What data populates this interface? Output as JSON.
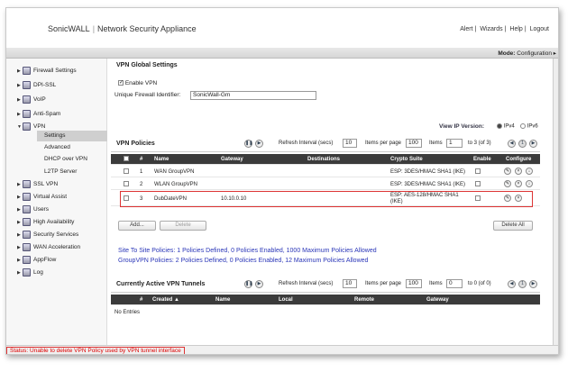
{
  "header": {
    "brand": "SonicWALL",
    "product": "Network Security Appliance",
    "links": [
      "Alert",
      "Wizards",
      "Help",
      "Logout"
    ]
  },
  "modebar": {
    "label": "Mode:",
    "value": "Configuration ▸"
  },
  "sidebar": {
    "items": [
      {
        "label": "Firewall Settings"
      },
      {
        "label": "DPI-SSL"
      },
      {
        "label": "VoIP"
      },
      {
        "label": "Anti-Spam"
      },
      {
        "label": "VPN"
      }
    ],
    "sub": [
      {
        "label": "Settings"
      },
      {
        "label": "Advanced"
      },
      {
        "label": "DHCP over VPN"
      },
      {
        "label": "L2TP Server"
      }
    ],
    "items2": [
      {
        "label": "SSL VPN"
      },
      {
        "label": "Virtual Assist"
      },
      {
        "label": "Users"
      },
      {
        "label": "High Availability"
      },
      {
        "label": "Security Services"
      },
      {
        "label": "WAN Acceleration"
      },
      {
        "label": "AppFlow"
      },
      {
        "label": "Log"
      }
    ]
  },
  "global": {
    "title": "VPN Global Settings",
    "enable_label": "Enable VPN",
    "uid_label": "Unique Firewall Identifier:",
    "uid_value": "SonicWall-Gm"
  },
  "ipversion": {
    "label": "View IP Version:",
    "v4": "IPv4",
    "v6": "IPv6"
  },
  "policies": {
    "title": "VPN Policies",
    "refresh_label": "Refresh Interval (secs)",
    "refresh_value": "10",
    "perpage_label": "Items per page",
    "perpage_value": "100",
    "items_label": "Items",
    "items_value": "1",
    "range": "to 3 (of 3)",
    "headers": [
      "#",
      "Name",
      "Gateway",
      "Destinations",
      "Crypto Suite",
      "Enable",
      "Configure"
    ],
    "rows": [
      {
        "num": "1",
        "name": "WAN GroupVPN",
        "gateway": "",
        "dest": "",
        "crypto": "ESP: 3DES/HMAC SHA1 (IKE)"
      },
      {
        "num": "2",
        "name": "WLAN GroupVPN",
        "gateway": "",
        "dest": "",
        "crypto": "ESP: 3DES/HMAC SHA1 (IKE)"
      },
      {
        "num": "3",
        "name": "DubDateVPN",
        "gateway": "10.10.0.10",
        "dest": "",
        "crypto": "ESP: AES-128/HMAC SHA1 (IKE)"
      }
    ],
    "add": "Add...",
    "delete": "Delete",
    "delete_all": "Delete All",
    "summary1": "Site To Site Policies: 1 Policies Defined, 0 Policies Enabled, 1000 Maximum Policies Allowed",
    "summary2": "GroupVPN Policies: 2 Policies Defined, 0 Policies Enabled, 12 Maximum Policies Allowed"
  },
  "tunnels": {
    "title": "Currently Active VPN Tunnels",
    "refresh_label": "Refresh Interval (secs)",
    "refresh_value": "10",
    "perpage_label": "Items per page",
    "perpage_value": "100",
    "items_label": "Items",
    "items_value": "0",
    "range": "to 0 (of 0)",
    "headers": [
      "#",
      "Created ▲",
      "Name",
      "Local",
      "Remote",
      "Gateway"
    ],
    "empty": "No Entries"
  },
  "status": {
    "text": "Status: Unable to delete VPN Policy used by VPN tunnel interface"
  },
  "colors": {
    "accent": "#2a36b8",
    "error": "#d33333",
    "header_bg": "#3b3b3b"
  }
}
